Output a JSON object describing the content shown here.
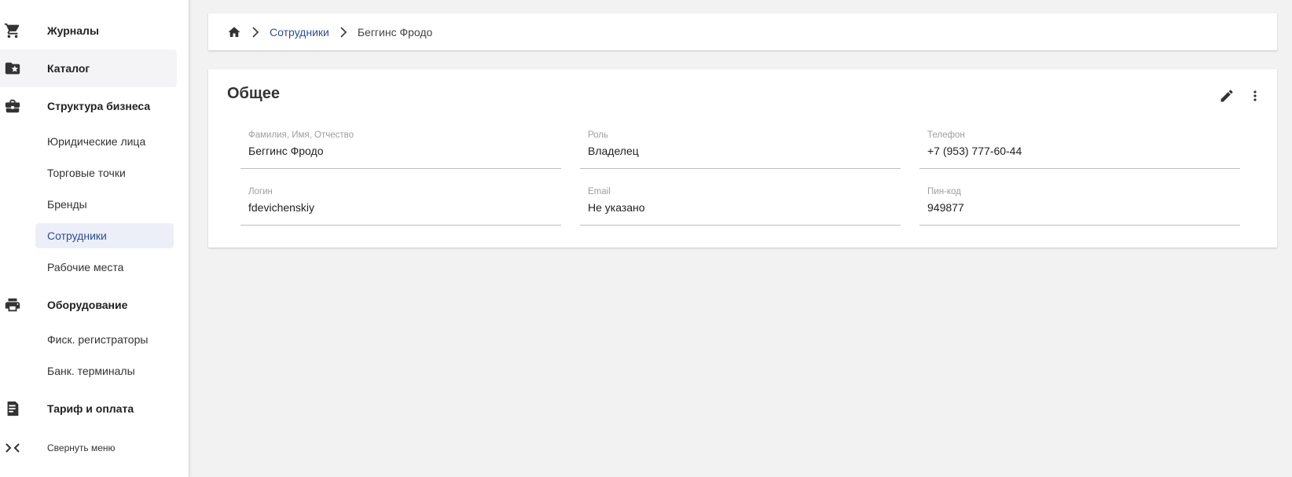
{
  "sidebar": {
    "groups": [
      {
        "label": "Журналы",
        "icon": "cart-icon"
      },
      {
        "label": "Каталог",
        "icon": "folder-star-icon"
      },
      {
        "label": "Структура бизнеса",
        "icon": "briefcase-icon"
      },
      {
        "label": "Оборудование",
        "icon": "printer-icon"
      },
      {
        "label": "Тариф и оплата",
        "icon": "receipt-icon"
      }
    ],
    "business_items": [
      "Юридические лица",
      "Торговые точки",
      "Бренды",
      "Сотрудники",
      "Рабочие места"
    ],
    "equipment_items": [
      "Фиск. регистраторы",
      "Банк. терминалы"
    ],
    "collapse_label": "Свернуть меню"
  },
  "breadcrumb": {
    "home_icon": "home-icon",
    "link": "Сотрудники",
    "current": "Беггинс Фродо"
  },
  "card": {
    "title": "Общее",
    "fields": [
      {
        "label": "Фамилия, Имя, Отчество",
        "value": "Беггинс Фродо"
      },
      {
        "label": "Роль",
        "value": "Владелец"
      },
      {
        "label": "Телефон",
        "value": "+7 (953) 777-60-44"
      },
      {
        "label": "Логин",
        "value": "fdevichenskiy"
      },
      {
        "label": "Email",
        "value": "Не указано"
      },
      {
        "label": "Пин-код",
        "value": "949877"
      }
    ]
  },
  "colors": {
    "accent": "#2f4d8f",
    "active_bg": "#eceff8",
    "page_bg": "#f2f2f2"
  }
}
